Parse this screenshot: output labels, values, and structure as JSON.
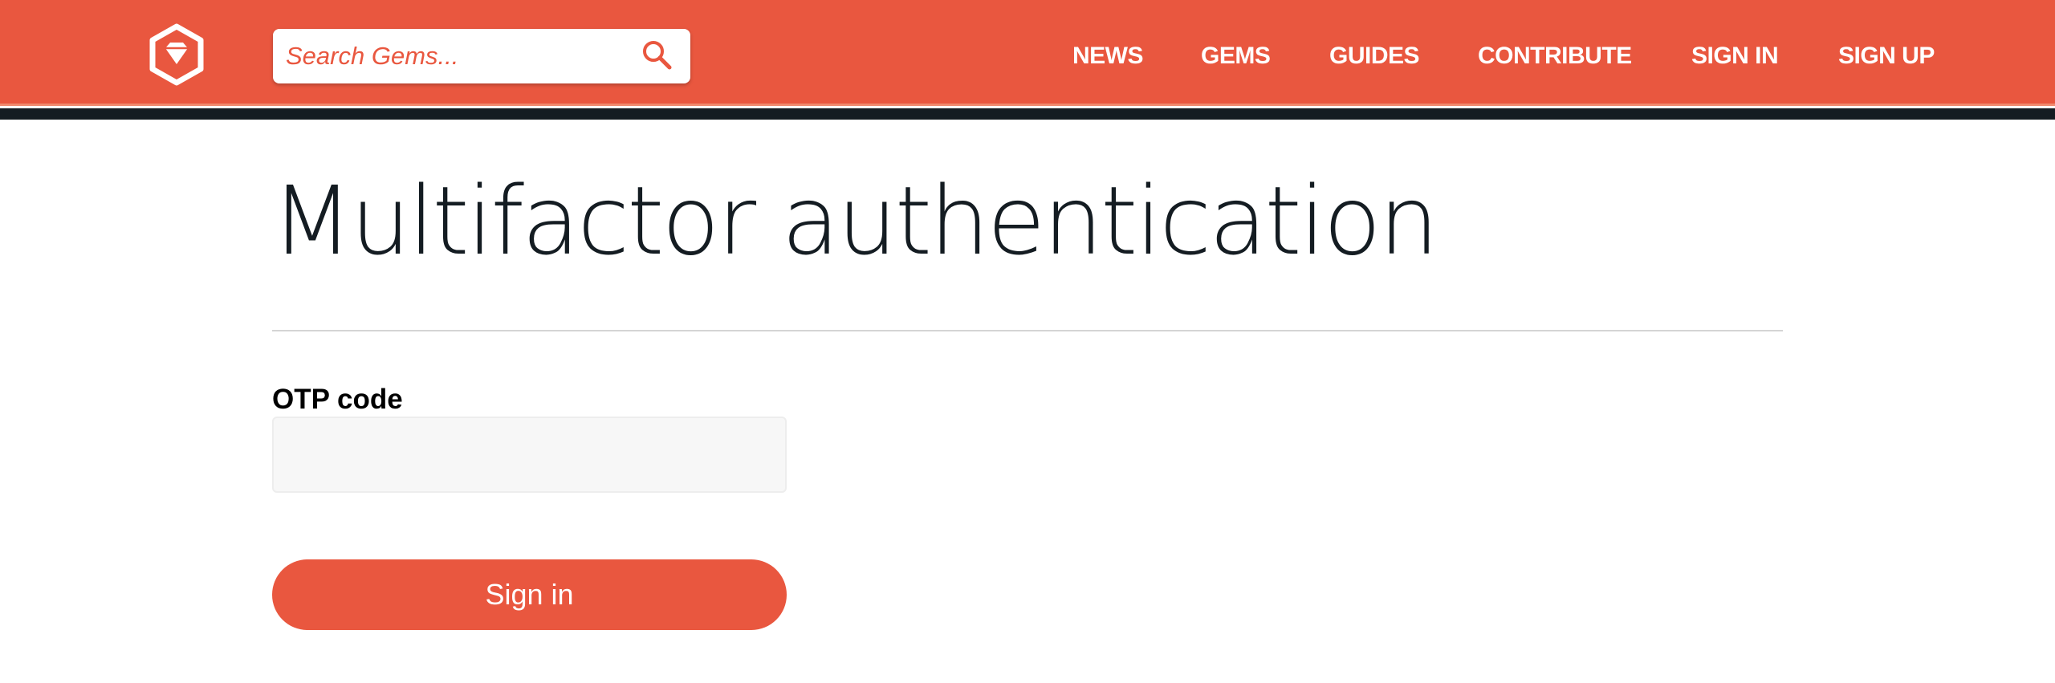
{
  "header": {
    "logo_icon": "hexagon-gem-icon",
    "search": {
      "placeholder": "Search Gems...",
      "value": "",
      "icon": "search-icon"
    },
    "nav": [
      {
        "label": "NEWS"
      },
      {
        "label": "GEMS"
      },
      {
        "label": "GUIDES"
      },
      {
        "label": "CONTRIBUTE"
      },
      {
        "label": "SIGN IN"
      },
      {
        "label": "SIGN UP"
      }
    ]
  },
  "main": {
    "title": "Multifactor authentication",
    "form": {
      "otp_label": "OTP code",
      "otp_value": "",
      "submit_label": "Sign in"
    }
  },
  "colors": {
    "brand": "#e9573f",
    "dark_band": "#141c22",
    "input_bg": "#f7f7f7"
  }
}
